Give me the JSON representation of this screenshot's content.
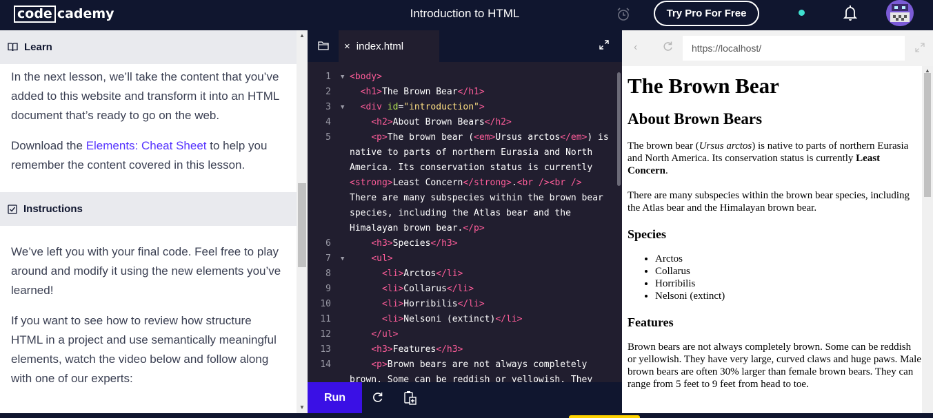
{
  "header": {
    "logo_code": "code",
    "logo_academy": "cademy",
    "title": "Introduction to HTML",
    "try_pro": "Try Pro For Free",
    "icons": [
      "clock-icon",
      "bell-icon",
      "avatar"
    ]
  },
  "learn": {
    "learn_heading": "Learn",
    "para1": "In the next lesson, we’ll take the content that you’ve added to this website and transform it into an HTML document that’s ready to go on the web.",
    "para2_before": "Download the ",
    "para2_link": "Elements: Cheat Sheet",
    "para2_after": " to help you remember the content covered in this lesson.",
    "instructions_heading": "Instructions",
    "para3": "We’ve left you with your final code. Feel free to play around and modify it using the new elements you’ve learned!",
    "para4": "If you want to see how to review how structure HTML in a project and use semantically meaningful elements, watch the video below and follow along with one of our experts:"
  },
  "editor": {
    "file_tab": "index.html",
    "close_glyph": "×",
    "run_label": "Run",
    "lines": [
      {
        "n": "1",
        "fold": true,
        "segs": [
          [
            "tg",
            "<body>"
          ]
        ]
      },
      {
        "n": "2",
        "fold": false,
        "segs": [
          [
            "tx",
            "  "
          ],
          [
            "tg",
            "<h1>"
          ],
          [
            "tx",
            "The Brown Bear"
          ],
          [
            "tg",
            "</h1>"
          ]
        ]
      },
      {
        "n": "3",
        "fold": true,
        "segs": [
          [
            "tx",
            "  "
          ],
          [
            "tg",
            "<div "
          ],
          [
            "at",
            "id"
          ],
          [
            "tx",
            "="
          ],
          [
            "st",
            "\"introduction\""
          ],
          [
            "tg",
            ">"
          ]
        ]
      },
      {
        "n": "4",
        "fold": false,
        "segs": [
          [
            "tx",
            "    "
          ],
          [
            "tg",
            "<h2>"
          ],
          [
            "tx",
            "About Brown Bears"
          ],
          [
            "tg",
            "</h2>"
          ]
        ]
      },
      {
        "n": "5",
        "fold": false,
        "segs": [
          [
            "tx",
            "    "
          ],
          [
            "tg",
            "<p>"
          ],
          [
            "tx",
            "The brown bear ("
          ],
          [
            "tg",
            "<em>"
          ],
          [
            "tx",
            "Ursus arctos"
          ],
          [
            "tg",
            "</em>"
          ],
          [
            "tx",
            ") is"
          ]
        ]
      },
      {
        "n": "",
        "fold": false,
        "segs": [
          [
            "tx",
            "native to parts of northern Eurasia and North"
          ]
        ]
      },
      {
        "n": "",
        "fold": false,
        "segs": [
          [
            "tx",
            "America. Its conservation status is currently"
          ]
        ]
      },
      {
        "n": "",
        "fold": false,
        "segs": [
          [
            "tg",
            "<strong>"
          ],
          [
            "tx",
            "Least Concern"
          ],
          [
            "tg",
            "</strong>"
          ],
          [
            "tx",
            "."
          ],
          [
            "tg",
            "<br />"
          ],
          [
            "tg",
            "<br />"
          ]
        ]
      },
      {
        "n": "",
        "fold": false,
        "segs": [
          [
            "tx",
            "There are many subspecies within the brown bear"
          ]
        ]
      },
      {
        "n": "",
        "fold": false,
        "segs": [
          [
            "tx",
            "species, including the Atlas bear and the"
          ]
        ]
      },
      {
        "n": "",
        "fold": false,
        "segs": [
          [
            "tx",
            "Himalayan brown bear."
          ],
          [
            "tg",
            "</p>"
          ]
        ]
      },
      {
        "n": "6",
        "fold": false,
        "segs": [
          [
            "tx",
            "    "
          ],
          [
            "tg",
            "<h3>"
          ],
          [
            "tx",
            "Species"
          ],
          [
            "tg",
            "</h3>"
          ]
        ]
      },
      {
        "n": "7",
        "fold": true,
        "segs": [
          [
            "tx",
            "    "
          ],
          [
            "tg",
            "<ul>"
          ]
        ]
      },
      {
        "n": "8",
        "fold": false,
        "segs": [
          [
            "tx",
            "      "
          ],
          [
            "tg",
            "<li>"
          ],
          [
            "tx",
            "Arctos"
          ],
          [
            "tg",
            "</li>"
          ]
        ]
      },
      {
        "n": "9",
        "fold": false,
        "segs": [
          [
            "tx",
            "      "
          ],
          [
            "tg",
            "<li>"
          ],
          [
            "tx",
            "Collarus"
          ],
          [
            "tg",
            "</li>"
          ]
        ]
      },
      {
        "n": "10",
        "fold": false,
        "segs": [
          [
            "tx",
            "      "
          ],
          [
            "tg",
            "<li>"
          ],
          [
            "tx",
            "Horribilis"
          ],
          [
            "tg",
            "</li>"
          ]
        ]
      },
      {
        "n": "11",
        "fold": false,
        "segs": [
          [
            "tx",
            "      "
          ],
          [
            "tg",
            "<li>"
          ],
          [
            "tx",
            "Nelsoni (extinct)"
          ],
          [
            "tg",
            "</li>"
          ]
        ]
      },
      {
        "n": "12",
        "fold": false,
        "segs": [
          [
            "tx",
            "    "
          ],
          [
            "tg",
            "</ul>"
          ]
        ]
      },
      {
        "n": "13",
        "fold": false,
        "segs": [
          [
            "tx",
            "    "
          ],
          [
            "tg",
            "<h3>"
          ],
          [
            "tx",
            "Features"
          ],
          [
            "tg",
            "</h3>"
          ]
        ]
      },
      {
        "n": "14",
        "fold": false,
        "segs": [
          [
            "tx",
            "    "
          ],
          [
            "tg",
            "<p>"
          ],
          [
            "tx",
            "Brown bears are not always completely"
          ]
        ]
      },
      {
        "n": "",
        "fold": false,
        "segs": [
          [
            "tx",
            "brown. Some can be reddish or yellowish. They"
          ]
        ]
      }
    ]
  },
  "browser": {
    "url": "https://localhost/",
    "h1": "The Brown Bear",
    "h2": "About Brown Bears",
    "p1_a": "The brown bear (",
    "p1_em": "Ursus arctos",
    "p1_b": ") is native to parts of northern Eurasia and North America. Its conservation status is currently ",
    "p1_strong": "Least Concern",
    "p1_c": ".",
    "p1_d": "There are many subspecies within the brown bear species, including the Atlas bear and the Himalayan brown bear.",
    "species_heading": "Species",
    "species": [
      "Arctos",
      "Collarus",
      "Horribilis",
      "Nelsoni (extinct)"
    ],
    "features_heading": "Features",
    "features_p": "Brown bears are not always completely brown. Some can be reddish or yellowish. They have very large, curved claws and huge paws. Male brown bears are often 30% larger than female brown bears. They can range from 5 feet to 9 feet from head to toe."
  },
  "colors": {
    "navy": "#10162f",
    "editor_bg": "#211e2f",
    "run_button": "#3a10e5",
    "link": "#5533ff",
    "tag": "#ff5d9a",
    "attr": "#b5e853",
    "string": "#ffe083"
  }
}
